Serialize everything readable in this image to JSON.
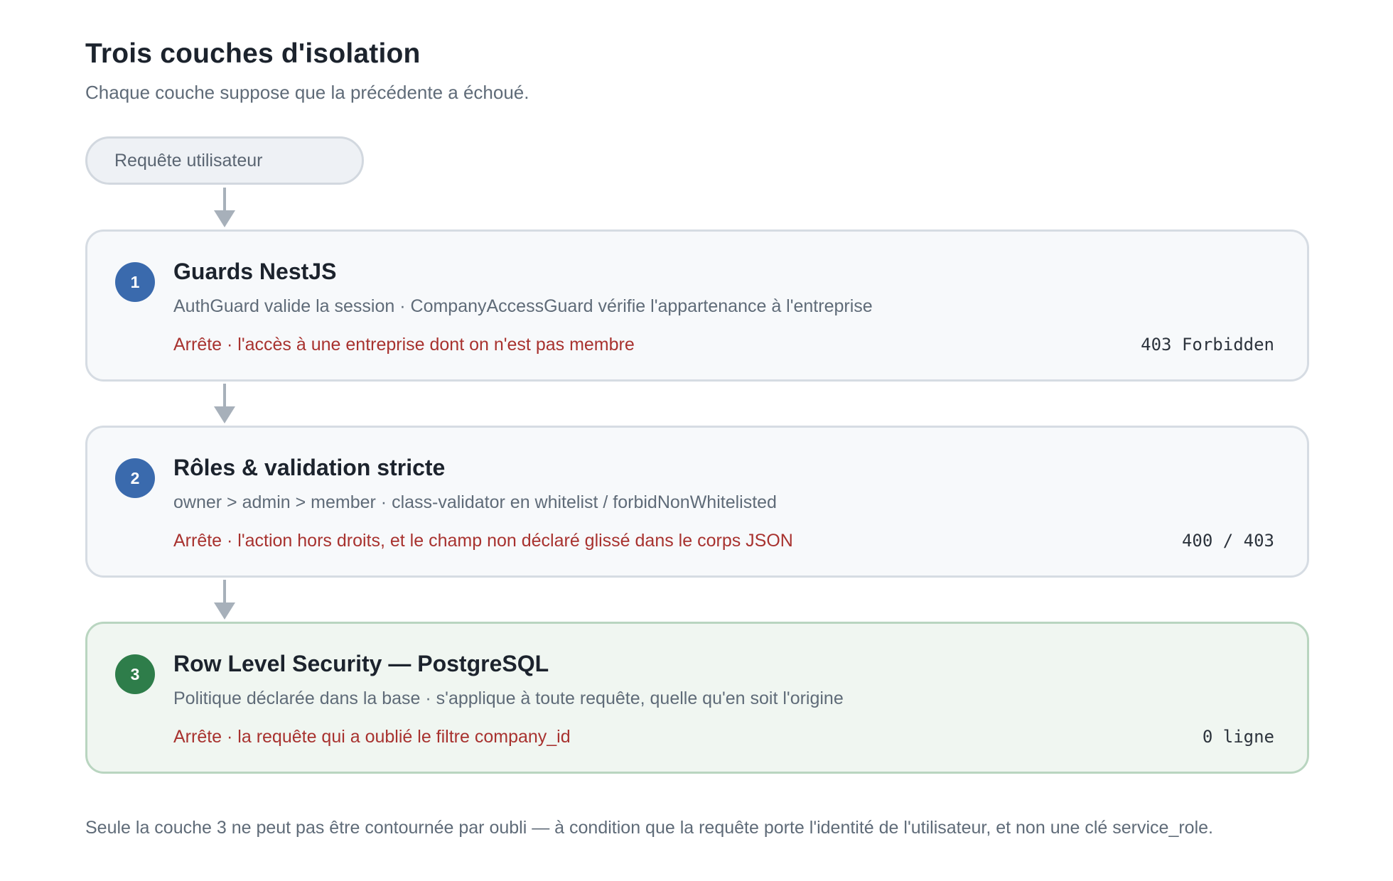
{
  "header": {
    "title": "Trois couches d'isolation",
    "subtitle": "Chaque couche suppose que la précédente a échoué."
  },
  "request": {
    "label": "Requête utilisateur"
  },
  "layers": [
    {
      "number": "1",
      "title": "Guards NestJS",
      "description": "AuthGuard valide la session · CompanyAccessGuard vérifie l'appartenance à l'entreprise",
      "stops": "Arrête · l'accès à une entreprise dont on n'est pas membre",
      "code": "403 Forbidden",
      "accent": "#3a6aad"
    },
    {
      "number": "2",
      "title": "Rôles & validation stricte",
      "description": "owner > admin > member · class-validator en whitelist / forbidNonWhitelisted",
      "stops": "Arrête · l'action hors droits, et le champ non déclaré glissé dans le corps JSON",
      "code": "400 / 403",
      "accent": "#3a6aad"
    },
    {
      "number": "3",
      "title": "Row Level Security — PostgreSQL",
      "description": "Politique déclarée dans la base · s'applique à toute requête, quelle qu'en soit l'origine",
      "stops": "Arrête · la requête qui a oublié le filtre company_id",
      "code": "0 ligne",
      "accent": "#2e7d4a"
    }
  ],
  "footnote": "Seule la couche 3 ne peut pas être contournée par oubli — à condition que la requête porte l'identité de l'utilisateur, et non une clé service_role."
}
